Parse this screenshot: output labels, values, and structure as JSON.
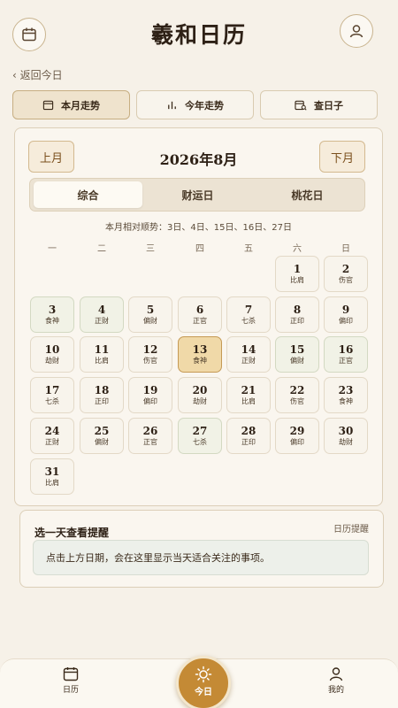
{
  "header": {
    "title": "羲和日历",
    "calendar_icon": "calendar-icon",
    "user_icon": "user-icon"
  },
  "back_link": "‹ 返回今日",
  "top_tabs": [
    {
      "label": "本月走势",
      "icon": "calendar-icon",
      "active": true
    },
    {
      "label": "今年走势",
      "icon": "bar-chart-icon",
      "active": false
    },
    {
      "label": "查日子",
      "icon": "calendar-search-icon",
      "active": false
    }
  ],
  "calendar": {
    "prev_label": "上月",
    "next_label": "下月",
    "month_title": "2026年8月",
    "segments": [
      {
        "label": "综合",
        "active": true
      },
      {
        "label": "财运日",
        "active": false
      },
      {
        "label": "桃花日",
        "active": false
      }
    ],
    "favor_line": "本月相对顺势：3日、4日、15日、16日、27日",
    "weekdays": [
      "一",
      "二",
      "三",
      "四",
      "五",
      "六",
      "日"
    ],
    "first_weekday_index": 5,
    "today": 13,
    "days": [
      {
        "n": "1",
        "tag": "比肩",
        "tint": false
      },
      {
        "n": "2",
        "tag": "伤官",
        "tint": false
      },
      {
        "n": "3",
        "tag": "食神",
        "tint": true
      },
      {
        "n": "4",
        "tag": "正财",
        "tint": true
      },
      {
        "n": "5",
        "tag": "偏财",
        "tint": false
      },
      {
        "n": "6",
        "tag": "正官",
        "tint": false
      },
      {
        "n": "7",
        "tag": "七杀",
        "tint": false
      },
      {
        "n": "8",
        "tag": "正印",
        "tint": false
      },
      {
        "n": "9",
        "tag": "偏印",
        "tint": false
      },
      {
        "n": "10",
        "tag": "劫财",
        "tint": false
      },
      {
        "n": "11",
        "tag": "比肩",
        "tint": false
      },
      {
        "n": "12",
        "tag": "伤官",
        "tint": false
      },
      {
        "n": "13",
        "tag": "食神",
        "tint": false
      },
      {
        "n": "14",
        "tag": "正财",
        "tint": false
      },
      {
        "n": "15",
        "tag": "偏财",
        "tint": true
      },
      {
        "n": "16",
        "tag": "正官",
        "tint": true
      },
      {
        "n": "17",
        "tag": "七杀",
        "tint": false
      },
      {
        "n": "18",
        "tag": "正印",
        "tint": false
      },
      {
        "n": "19",
        "tag": "偏印",
        "tint": false
      },
      {
        "n": "20",
        "tag": "劫财",
        "tint": false
      },
      {
        "n": "21",
        "tag": "比肩",
        "tint": false
      },
      {
        "n": "22",
        "tag": "伤官",
        "tint": false
      },
      {
        "n": "23",
        "tag": "食神",
        "tint": false
      },
      {
        "n": "24",
        "tag": "正财",
        "tint": false
      },
      {
        "n": "25",
        "tag": "偏财",
        "tint": false
      },
      {
        "n": "26",
        "tag": "正官",
        "tint": false
      },
      {
        "n": "27",
        "tag": "七杀",
        "tint": true
      },
      {
        "n": "28",
        "tag": "正印",
        "tint": false
      },
      {
        "n": "29",
        "tag": "偏印",
        "tint": false
      },
      {
        "n": "30",
        "tag": "劫财",
        "tint": false
      },
      {
        "n": "31",
        "tag": "比肩",
        "tint": false
      }
    ]
  },
  "reminder": {
    "title": "选一天查看提醒",
    "link": "日历提醒",
    "body": "点击上方日期，会在这里显示当天适合关注的事项。"
  },
  "bottom_nav": {
    "calendar_label": "日历",
    "today_label": "今日",
    "me_label": "我的"
  },
  "colors": {
    "accent": "#c48a35",
    "background": "#f6f1e8",
    "today_cell": "#f0d9a8"
  }
}
